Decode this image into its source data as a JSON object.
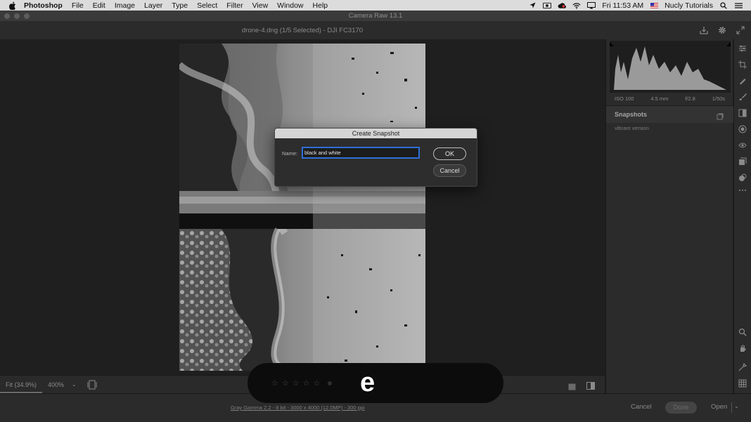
{
  "menubar": {
    "app_name": "Photoshop",
    "items": [
      "File",
      "Edit",
      "Image",
      "Layer",
      "Type",
      "Select",
      "Filter",
      "View",
      "Window",
      "Help"
    ],
    "clock": "Fri 11:53 AM",
    "user": "Nucly Tutorials",
    "status_icons": [
      "location-icon",
      "screen-record-icon",
      "creative-cloud-icon",
      "wifi-icon",
      "airplay-icon",
      "flag-icon",
      "search-icon",
      "menu-icon"
    ]
  },
  "window": {
    "title": "Camera Raw 13.1"
  },
  "header": {
    "file_info": "drone-4.dng (1/5 Selected)  -  DJI FC3170",
    "icons": [
      "save-icon",
      "settings-icon",
      "fullscreen-icon"
    ]
  },
  "histogram": {
    "iso": "ISO 100",
    "focal": "4.5 mm",
    "aperture": "f/2.8",
    "shutter": "1/50s"
  },
  "snapshots": {
    "title": "Snapshots",
    "items": [
      "vibrant version"
    ]
  },
  "dialog": {
    "title": "Create Snapshot",
    "name_label": "Name:",
    "name_value": "black and white",
    "ok_label": "OK",
    "cancel_label": "Cancel"
  },
  "bottom_toolbar": {
    "fit_label": "Fit (34.9%)",
    "zoom_label": "400%",
    "zoom_chevron": "⌄"
  },
  "rating_overlay": {
    "stars": "☆☆☆☆☆",
    "key_pressed": "e",
    "rating_stars": 0
  },
  "footer": {
    "image_info": "Gray Gamma 2.2 - 8 bit - 3000 x 4000 (12.0MP) - 300 ppi",
    "cancel_label": "Cancel",
    "done_label": "Done",
    "open_label": "Open",
    "open_chevron": "⌄"
  },
  "colors": {
    "panel_bg": "#2b2b2b",
    "canvas_bg": "#1f1f1f",
    "focus_blue": "#2f6fd6"
  }
}
